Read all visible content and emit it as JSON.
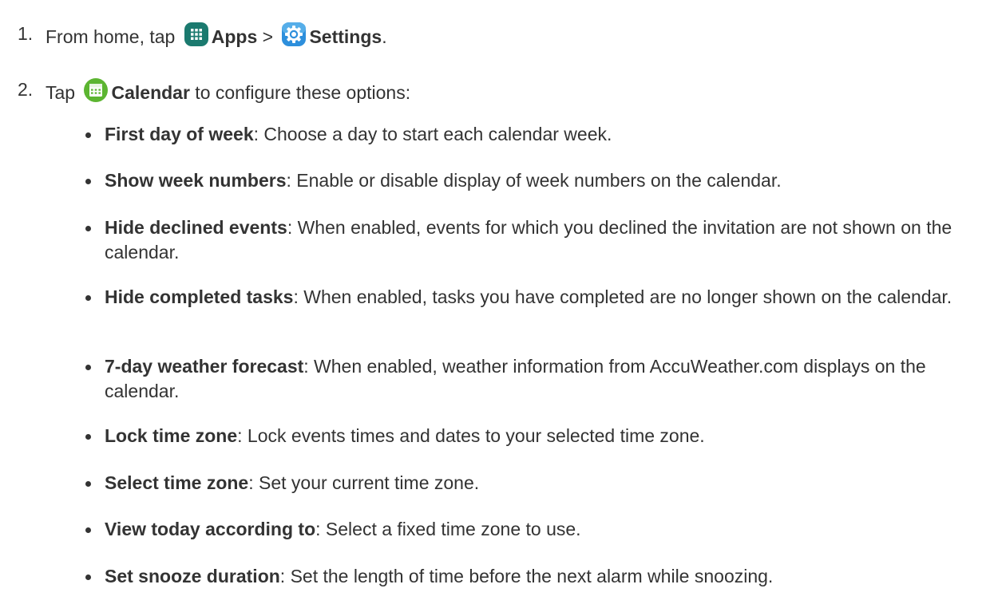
{
  "step1": {
    "number": "1.",
    "prefix": "From home, tap ",
    "apps_icon": "apps-grid-icon",
    "apps_label": "Apps",
    "separator": " > ",
    "settings_icon": "settings-gear-icon",
    "settings_label": "Settings",
    "suffix": "."
  },
  "step2": {
    "number": "2.",
    "prefix": "Tap ",
    "calendar_icon": "calendar-icon",
    "calendar_label": "Calendar",
    "suffix": " to configure these options:"
  },
  "options": [
    {
      "term": "First day of week",
      "desc": ": Choose a day to start each calendar week."
    },
    {
      "term": "Show week numbers",
      "desc": ": Enable or disable display of week numbers on the calendar."
    },
    {
      "term": "Hide declined events",
      "desc": ": When enabled, events for which you declined the invitation are not shown on the calendar."
    },
    {
      "term": "Hide completed tasks",
      "desc": ": When enabled, tasks you have completed are no longer shown on the calendar."
    },
    {
      "term": "7-day weather forecast",
      "desc": ": When enabled, weather information from AccuWeather.com displays on the calendar."
    },
    {
      "term": "Lock time zone",
      "desc": ": Lock events times and dates to your selected time zone."
    },
    {
      "term": "Select time zone",
      "desc": ": Set your current time zone."
    },
    {
      "term": "View today according to",
      "desc": ": Select a fixed time zone to use."
    },
    {
      "term": "Set snooze duration",
      "desc": ": Set the length of time before the next alarm while snoozing."
    }
  ],
  "colors": {
    "text": "#333333",
    "apps_icon": "#1b7a6f",
    "settings_icon": "#2d8fdc",
    "calendar_icon": "#5cb531"
  }
}
